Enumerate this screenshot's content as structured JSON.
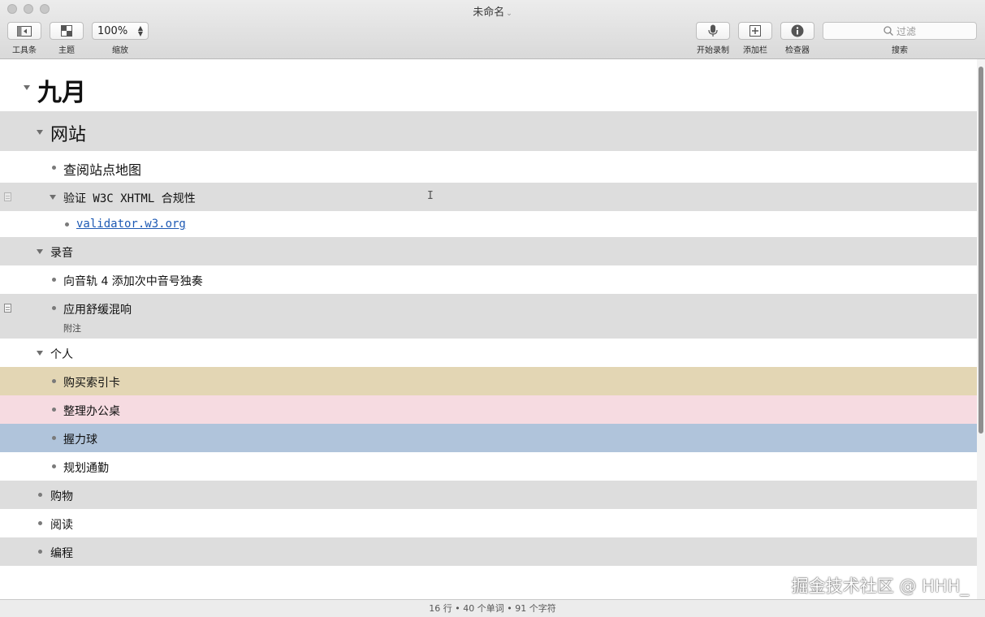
{
  "window": {
    "title": "未命名"
  },
  "toolbar": {
    "toolbar_label": "工具条",
    "theme_label": "主题",
    "zoom_value": "100%",
    "zoom_label": "缩放",
    "record_label": "开始录制",
    "add_column_label": "添加栏",
    "inspector_label": "检查器",
    "search_placeholder": "过滤",
    "search_label": "搜索"
  },
  "outline": {
    "september": "九月",
    "website": "网站",
    "sitemap": "查阅站点地图",
    "validate": "验证 W3C XHTML 合规性",
    "validator_link": "validator.w3.org",
    "recording": "录音",
    "tenor_solo": "向音轨 4 添加次中音号独奏",
    "reverb": "应用舒缓混响",
    "reverb_note": "附注",
    "personal": "个人",
    "buy_cards": "购买索引卡",
    "desk": "整理办公桌",
    "grip_ball": "握力球",
    "commute": "规划通勤",
    "shopping": "购物",
    "reading": "阅读",
    "programming": "编程"
  },
  "colors": {
    "tan_row": "#e3d6b4",
    "pink_row": "#f6dbe1",
    "blue_row": "#b0c4db",
    "link": "#1e5ab4"
  },
  "statusbar": {
    "text": "16 行 • 40 个单词 • 91 个字符"
  },
  "watermark": {
    "text": "掘金技术社区 @ HHH_"
  }
}
